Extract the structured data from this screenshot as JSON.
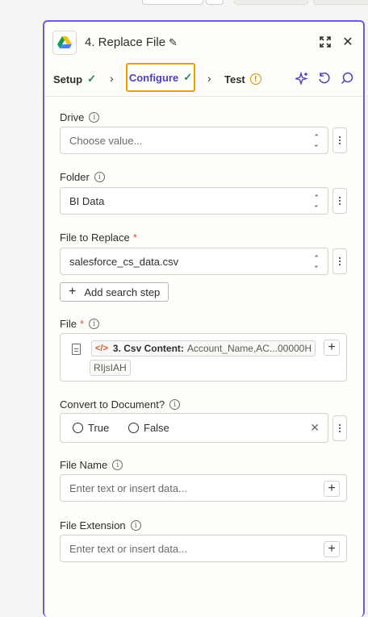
{
  "header": {
    "title": "4. Replace File",
    "icons": [
      "google-drive-icon",
      "pencil-icon",
      "expand-icon",
      "close-icon"
    ]
  },
  "steps": [
    {
      "label": "Setup",
      "status": "complete"
    },
    {
      "label": "Configure",
      "status": "complete",
      "active": true
    },
    {
      "label": "Test",
      "status": "warning"
    }
  ],
  "step_icons": [
    "ai-sparkle-icon",
    "undo-icon",
    "comment-icon"
  ],
  "fields": {
    "drive": {
      "label": "Drive",
      "placeholder": "Choose value..."
    },
    "folder": {
      "label": "Folder",
      "value": "BI Data"
    },
    "file_to_replace": {
      "label": "File to Replace",
      "required_mark": "*",
      "value": "salesforce_cs_data.csv"
    },
    "add_search_step": {
      "label": "Add search step"
    },
    "file": {
      "label": "File",
      "required_mark": "*",
      "mapped_step": "3. Csv Content:",
      "mapped_value": "Account_Name,AC...00000H",
      "mapped_value_cont": "RIjsIAH"
    },
    "convert": {
      "label": "Convert to Document?",
      "options": [
        "True",
        "False"
      ]
    },
    "file_name": {
      "label": "File Name",
      "placeholder": "Enter text or insert data..."
    },
    "file_extension": {
      "label": "File Extension",
      "placeholder": "Enter text or insert data..."
    }
  },
  "colors": {
    "accent": "#695be8",
    "active_step_border": "#e3a100",
    "success": "#1d8a5a",
    "required": "#d8552b"
  }
}
